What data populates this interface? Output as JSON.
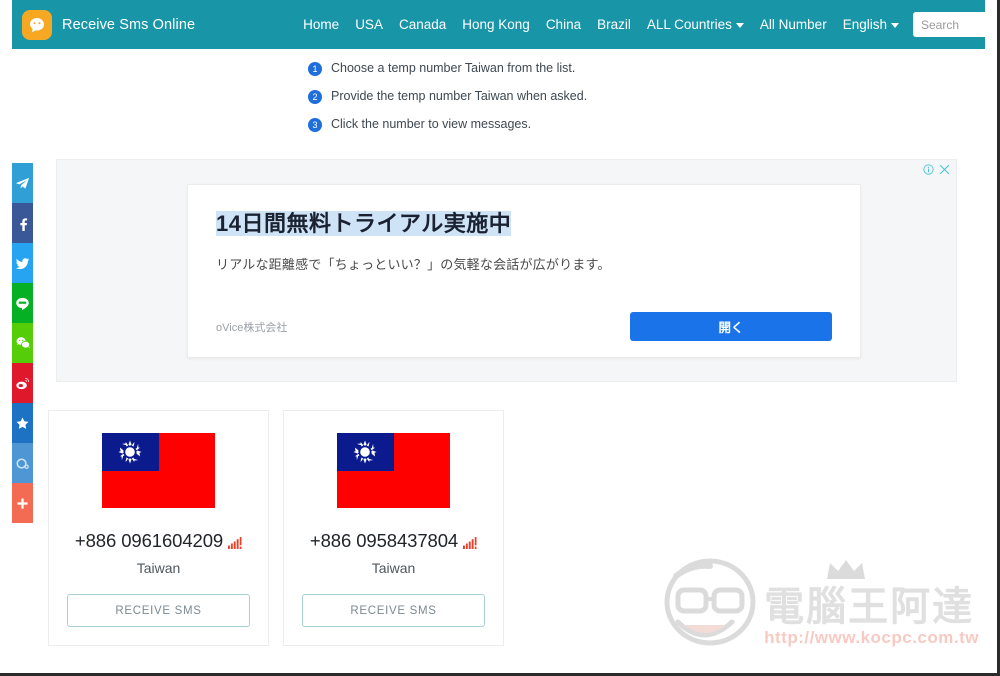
{
  "navbar": {
    "brand": "Receive Sms Online",
    "brand_icon": "chat-smiley-icon",
    "background_color": "#1896a8",
    "links": [
      {
        "label": "Home",
        "dropdown": false
      },
      {
        "label": "USA",
        "dropdown": false
      },
      {
        "label": "Canada",
        "dropdown": false
      },
      {
        "label": "Hong Kong",
        "dropdown": false
      },
      {
        "label": "China",
        "dropdown": false
      },
      {
        "label": "Brazil",
        "dropdown": false
      },
      {
        "label": "ALL Countries",
        "dropdown": true
      },
      {
        "label": "All Number",
        "dropdown": false
      },
      {
        "label": "English",
        "dropdown": true
      }
    ],
    "search": {
      "value": "",
      "placeholder": "Search",
      "icon": "search-icon"
    }
  },
  "social_rail": [
    {
      "name": "telegram",
      "color": "#2f9fd6"
    },
    {
      "name": "facebook",
      "color": "#3a5897"
    },
    {
      "name": "twitter",
      "color": "#26a4f2"
    },
    {
      "name": "line",
      "color": "#06b025"
    },
    {
      "name": "wechat",
      "color": "#55cd09"
    },
    {
      "name": "weibo",
      "color": "#e0182c"
    },
    {
      "name": "kakao-star",
      "color": "#1d72c4"
    },
    {
      "name": "plurk",
      "color": "#4e97d4"
    },
    {
      "name": "share-more",
      "color": "#f26b52"
    }
  ],
  "steps": [
    {
      "number": "1",
      "text": "Choose a temp number Taiwan from the list."
    },
    {
      "number": "2",
      "text": "Provide the temp number Taiwan when asked."
    },
    {
      "number": "3",
      "text": "Click the number to view messages."
    }
  ],
  "ad": {
    "info_icon": "info-circle-icon",
    "close_icon": "close-icon",
    "headline": "14日間無料トライアル実施中",
    "subtext": "リアルな距離感で「ちょっといい？」の気軽な会話が広がります。",
    "advertiser": "oVice株式会社",
    "cta_label": "開く",
    "cta_color": "#1a73e8",
    "highlight_color": "#cfe3f7"
  },
  "cards": [
    {
      "flag": "taiwan-flag",
      "number": "+886 0961604209",
      "signal_icon": "signal-bars-icon",
      "country": "Taiwan",
      "button_label": "RECEIVE SMS"
    },
    {
      "flag": "taiwan-flag",
      "number": "+886 0958437804",
      "signal_icon": "signal-bars-icon",
      "country": "Taiwan",
      "button_label": "RECEIVE SMS"
    }
  ],
  "watermark": {
    "mascot_icon": "cartoon-face-icon",
    "crown_icon": "crown-icon",
    "title": "電腦王阿達",
    "url": "http://www.kocpc.com.tw"
  }
}
